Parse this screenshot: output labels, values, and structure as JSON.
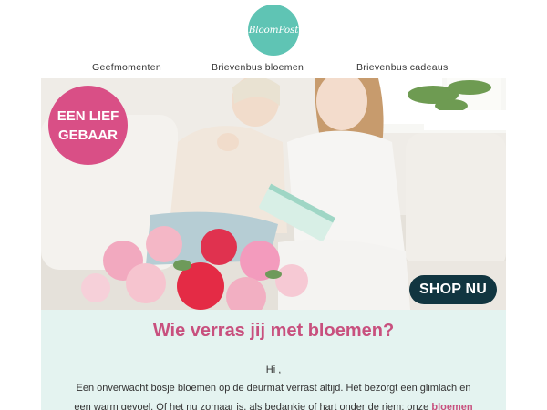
{
  "brand": {
    "logo_text": "BloomPost"
  },
  "nav": {
    "items": [
      "Geefmomenten",
      "Brievenbus bloemen",
      "Brievenbus cadeaus"
    ]
  },
  "hero": {
    "badge_line1": "EEN LIEF",
    "badge_line2": "GEBAAR",
    "cta_label": "SHOP NU"
  },
  "content": {
    "headline": "Wie verras jij met bloemen?",
    "greeting": "Hi ,",
    "body_line1": "Een onverwacht bosje bloemen op de deurmat verrast altijd. Het bezorgt een glimlach en",
    "body_line2": "een warm gevoel. Of het nu zomaar is, als bedankje of hart onder de riem: onze ",
    "body_link": "bloemen"
  },
  "colors": {
    "accent_pink": "#d94f86",
    "logo_teal": "#5fc4b4",
    "cta_dark": "#113540",
    "panel_mint": "#e4f3f0"
  }
}
